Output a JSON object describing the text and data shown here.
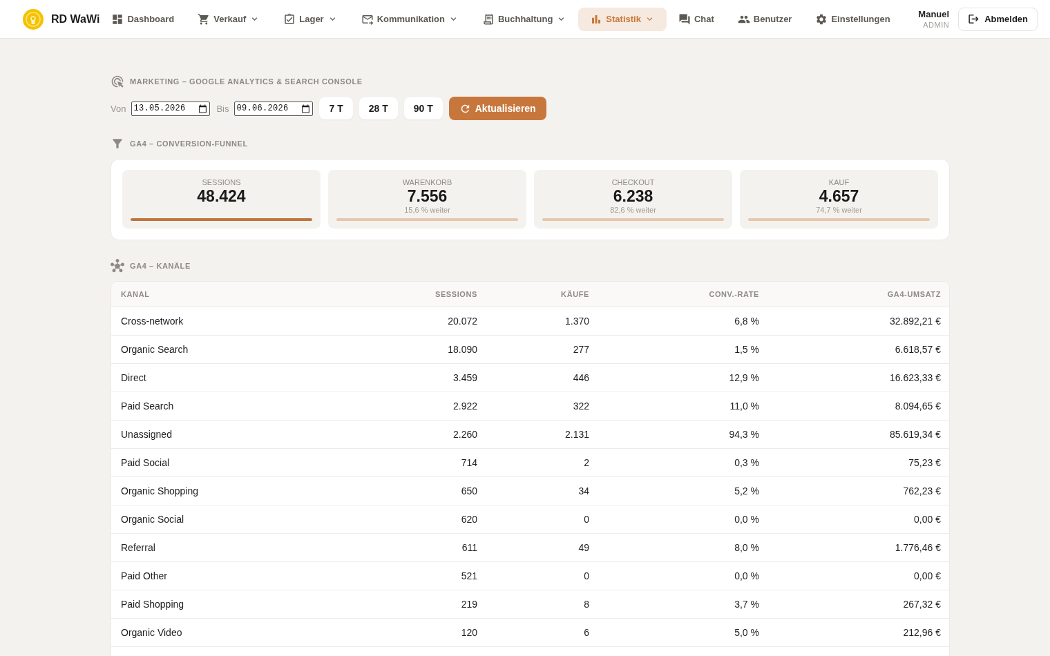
{
  "nav": {
    "brand": "RD WaWi",
    "items": [
      {
        "label": "Dashboard",
        "has_menu": false,
        "selected": false
      },
      {
        "label": "Verkauf",
        "has_menu": true,
        "selected": false
      },
      {
        "label": "Lager",
        "has_menu": true,
        "selected": false
      },
      {
        "label": "Kommunikation",
        "has_menu": true,
        "selected": false
      },
      {
        "label": "Buchhaltung",
        "has_menu": true,
        "selected": false
      },
      {
        "label": "Statistik",
        "has_menu": true,
        "selected": true
      },
      {
        "label": "Chat",
        "has_menu": false,
        "selected": false
      },
      {
        "label": "Benutzer",
        "has_menu": false,
        "selected": false
      },
      {
        "label": "Einstellungen",
        "has_menu": false,
        "selected": false
      }
    ],
    "user": {
      "name": "Manuel",
      "role": "ADMIN"
    },
    "logout": "Abmelden"
  },
  "marketing": {
    "title": "MARKETING – GOOGLE ANALYTICS & SEARCH CONSOLE",
    "from_label": "Von",
    "from": "13.05.2026",
    "to_label": "Bis",
    "to": "09.06.2026",
    "ranges": [
      "7 T",
      "28 T",
      "90 T"
    ],
    "refresh": "Aktualisieren"
  },
  "funnel": {
    "title": "GA4 – CONVERSION-FUNNEL",
    "stages": [
      {
        "label": "SESSIONS",
        "value": "48.424",
        "highlighted": true
      },
      {
        "label": "WARENKORB",
        "value": "7.556",
        "rate": "15,6 % weiter",
        "highlighted": false
      },
      {
        "label": "CHECKOUT",
        "value": "6.238",
        "rate": "82,6 % weiter",
        "highlighted": false
      },
      {
        "label": "KAUF",
        "value": "4.657",
        "rate": "74,7 % weiter",
        "highlighted": false
      }
    ]
  },
  "channels": {
    "title": "GA4 – KANÄLE",
    "columns": [
      "KANAL",
      "SESSIONS",
      "KÄUFE",
      "CONV.-RATE",
      "GA4-UMSATZ"
    ],
    "rows": [
      [
        "Cross-network",
        "20.072",
        "1.370",
        "6,8 %",
        "32.892,21 €"
      ],
      [
        "Organic Search",
        "18.090",
        "277",
        "1,5 %",
        "6.618,57 €"
      ],
      [
        "Direct",
        "3.459",
        "446",
        "12,9 %",
        "16.623,33 €"
      ],
      [
        "Paid Search",
        "2.922",
        "322",
        "11,0 %",
        "8.094,65 €"
      ],
      [
        "Unassigned",
        "2.260",
        "2.131",
        "94,3 %",
        "85.619,34 €"
      ],
      [
        "Paid Social",
        "714",
        "2",
        "0,3 %",
        "75,23 €"
      ],
      [
        "Organic Shopping",
        "650",
        "34",
        "5,2 %",
        "762,23 €"
      ],
      [
        "Organic Social",
        "620",
        "0",
        "0,0 %",
        "0,00 €"
      ],
      [
        "Referral",
        "611",
        "49",
        "8,0 %",
        "1.776,46 €"
      ],
      [
        "Paid Other",
        "521",
        "0",
        "0,0 %",
        "0,00 €"
      ],
      [
        "Paid Shopping",
        "219",
        "8",
        "3,7 %",
        "267,32 €"
      ],
      [
        "Organic Video",
        "120",
        "6",
        "5,0 %",
        "212,96 €"
      ]
    ]
  }
}
